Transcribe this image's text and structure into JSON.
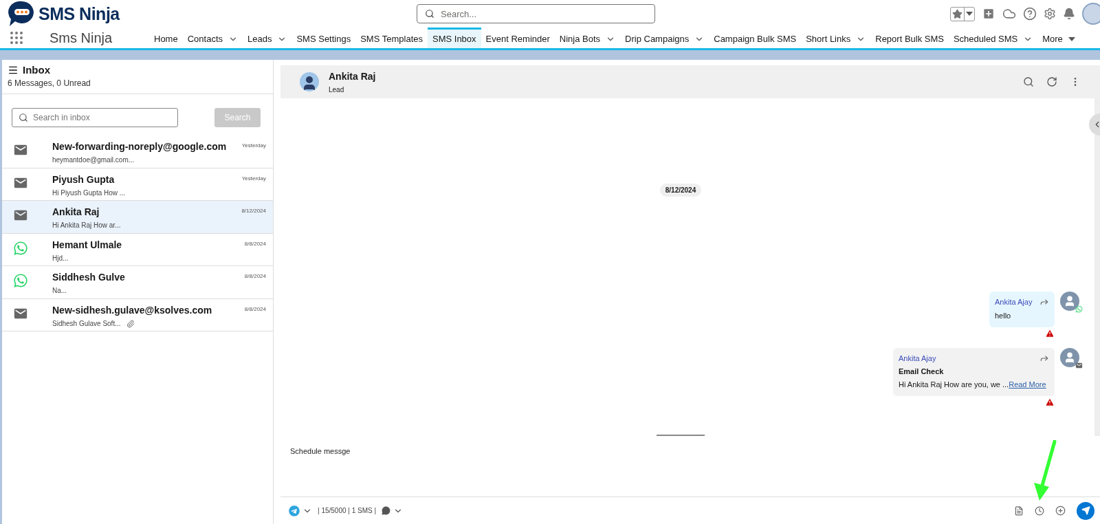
{
  "app": {
    "logo_text": "SMS Ninja",
    "app_name": "Sms Ninja"
  },
  "search": {
    "placeholder": "Search..."
  },
  "nav": [
    {
      "label": "Home",
      "kind": "link",
      "selected": false
    },
    {
      "label": "Contacts",
      "kind": "dropdown",
      "selected": false
    },
    {
      "label": "Leads",
      "kind": "dropdown",
      "selected": false
    },
    {
      "label": "SMS Settings",
      "kind": "link",
      "selected": false
    },
    {
      "label": "SMS Templates",
      "kind": "link",
      "selected": false
    },
    {
      "label": "SMS Inbox",
      "kind": "link",
      "selected": true
    },
    {
      "label": "Event Reminder",
      "kind": "link",
      "selected": false
    },
    {
      "label": "Ninja Bots",
      "kind": "dropdown",
      "selected": false
    },
    {
      "label": "Drip Campaigns",
      "kind": "dropdown",
      "selected": false
    },
    {
      "label": "Campaign Bulk SMS",
      "kind": "link",
      "selected": false
    },
    {
      "label": "Short Links",
      "kind": "dropdown",
      "selected": false
    },
    {
      "label": "Report Bulk SMS",
      "kind": "link",
      "selected": false
    },
    {
      "label": "Scheduled SMS",
      "kind": "dropdown",
      "selected": false
    },
    {
      "label": "More",
      "kind": "overflow",
      "selected": false
    }
  ],
  "inbox": {
    "title": "Inbox",
    "summary": "6 Messages, 0 Unread",
    "search_placeholder": "Search in inbox",
    "search_button": {
      "label": "Search",
      "disabled": true
    },
    "items": [
      {
        "kind": "email",
        "name": "New-forwarding-noreply@google.com",
        "preview": "heymantdoe@gmail.com...",
        "time": "Yesterday",
        "selected": false,
        "attachment": false
      },
      {
        "kind": "email",
        "name": "Piyush Gupta",
        "preview": "Hi Piyush Gupta How ...",
        "time": "Yesterday",
        "selected": false,
        "attachment": false
      },
      {
        "kind": "email",
        "name": "Ankita Raj",
        "preview": "Hi Ankita Raj How ar...",
        "time": "8/12/2024",
        "selected": true,
        "attachment": false
      },
      {
        "kind": "whatsapp",
        "name": "Hemant Ulmale",
        "preview": "Hjd...",
        "time": "8/8/2024",
        "selected": false,
        "attachment": false
      },
      {
        "kind": "whatsapp",
        "name": "Siddhesh Gulve",
        "preview": "Na...",
        "time": "8/8/2024",
        "selected": false,
        "attachment": false
      },
      {
        "kind": "email",
        "name": "New-sidhesh.gulave@ksolves.com",
        "preview": "Sidhesh Gulave Soft...",
        "time": "8/8/2024",
        "selected": false,
        "attachment": true
      }
    ]
  },
  "conversation": {
    "name": "Ankita Raj",
    "subtitle": "Lead",
    "date": "8/12/2024",
    "messages": [
      {
        "kind": "whatsapp",
        "sender": "Ankita Ajay",
        "text": "hello",
        "failed": true
      },
      {
        "kind": "email",
        "sender": "Ankita Ajay",
        "subject": "Email Check",
        "text": "Hi Ankita Raj How are you, we ...",
        "link": "Read More",
        "failed": true
      }
    ]
  },
  "composer": {
    "value": "Schedule messge",
    "counter": "| 15/5000 | 1 SMS |"
  }
}
